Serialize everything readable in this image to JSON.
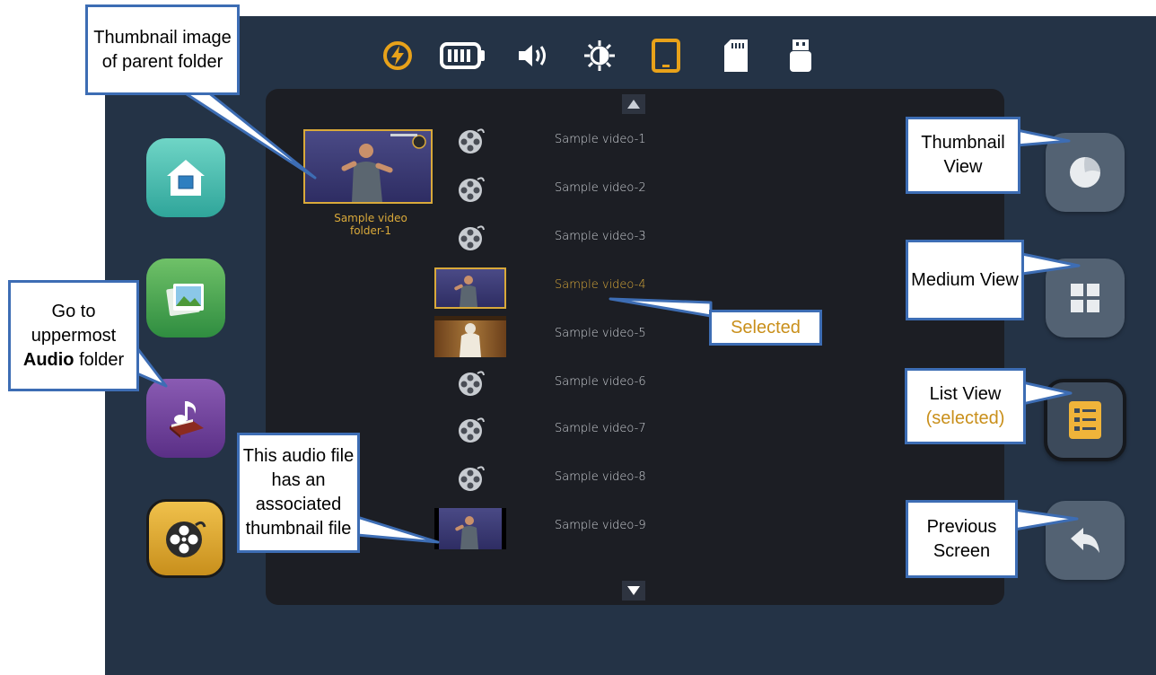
{
  "status_bar": {
    "icons": [
      "charging-icon",
      "battery-icon",
      "volume-icon",
      "brightness-icon",
      "tablet-icon",
      "sd-card-icon",
      "usb-drive-icon"
    ]
  },
  "folder": {
    "thumbnail_caption": "Sample video folder-1"
  },
  "files": [
    {
      "label": "Sample video-1",
      "icon": "film-reel-icon",
      "selected": false
    },
    {
      "label": "Sample video-2",
      "icon": "film-reel-icon",
      "selected": false
    },
    {
      "label": "Sample video-3",
      "icon": "film-reel-icon",
      "selected": false
    },
    {
      "label": "Sample video-4",
      "icon": "video-thumbnail",
      "selected": true
    },
    {
      "label": "Sample video-5",
      "icon": "video-thumbnail",
      "selected": false
    },
    {
      "label": "Sample video-6",
      "icon": "film-reel-icon",
      "selected": false
    },
    {
      "label": "Sample video-7",
      "icon": "film-reel-icon",
      "selected": false
    },
    {
      "label": "Sample video-8",
      "icon": "film-reel-icon",
      "selected": false
    },
    {
      "label": "Sample video-9",
      "icon": "video-thumbnail",
      "selected": false
    }
  ],
  "callouts": {
    "parent_thumb": "Thumbnail image of parent folder",
    "audio_folder_pre": "Go to uppermost",
    "audio_folder_bold": "Audio",
    "audio_folder_post": "folder",
    "thumb_audio": "This audio file has an associated thumbnail file",
    "selected": "Selected",
    "thumbnail_view": "Thumbnail View",
    "medium_view": "Medium View",
    "list_view": "List View",
    "list_view_selected": "(selected)",
    "previous_screen": "Previous Screen"
  },
  "colors": {
    "background": "#243346",
    "panel": "#1c1e24",
    "accent": "#d9a93a",
    "callout_border": "#3d6db4",
    "right_button": "#536273"
  }
}
